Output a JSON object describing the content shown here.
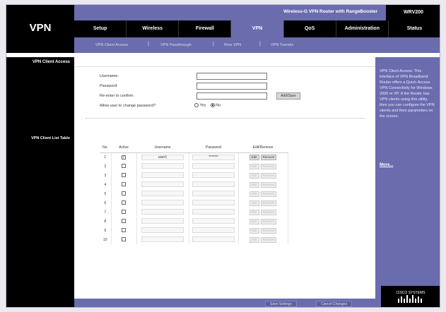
{
  "header": {
    "page_title": "VPN",
    "product_name": "Wireless-G VPN Router with RangeBooster",
    "model": "WRV200"
  },
  "tabs": [
    {
      "label": "Setup"
    },
    {
      "label": "Wireless"
    },
    {
      "label": "Firewall"
    },
    {
      "label": "VPN",
      "active": true
    },
    {
      "label": "QoS"
    },
    {
      "label": "Administration"
    },
    {
      "label": "Status"
    }
  ],
  "subtabs": [
    "VPN Client Access",
    "VPN Passthrough",
    "Rms VPN",
    "VPN Tunnels"
  ],
  "left": {
    "section1": "VPN Client Access",
    "section2": "VPN Client List Table"
  },
  "form": {
    "username_label": "Username:",
    "password_label": "Password:",
    "reenter_label": "Re-enter to confirm:",
    "allow_change_label": "Allow user to change password?",
    "yes_label": "Yes",
    "no_label": "No",
    "add_button": "Add/Save",
    "username_value": "",
    "password_value": "",
    "reenter_value": ""
  },
  "table": {
    "headers": [
      "No.",
      "Active",
      "Username",
      "Password",
      "Edit/Remove"
    ],
    "edit_label": "Edit",
    "remove_label": "Remove",
    "rows": [
      {
        "no": "1",
        "active": true,
        "username": "user1",
        "password": "*******"
      },
      {
        "no": "2",
        "active": false,
        "username": "",
        "password": ""
      },
      {
        "no": "3",
        "active": false,
        "username": "",
        "password": ""
      },
      {
        "no": "4",
        "active": false,
        "username": "",
        "password": ""
      },
      {
        "no": "5",
        "active": false,
        "username": "",
        "password": ""
      },
      {
        "no": "6",
        "active": false,
        "username": "",
        "password": ""
      },
      {
        "no": "7",
        "active": false,
        "username": "",
        "password": ""
      },
      {
        "no": "8",
        "active": false,
        "username": "",
        "password": ""
      },
      {
        "no": "9",
        "active": false,
        "username": "",
        "password": ""
      },
      {
        "no": "10",
        "active": false,
        "username": "",
        "password": ""
      }
    ]
  },
  "help": {
    "text": "VPN Client Access: This interface of VPN Broadband Router offers a Quick-Access VPN Connectivity for Windows 2000 or XP. A the Router has VPN clients using this utility, then you can configure the VPN clients and their parameters on the screen.",
    "more": "More..."
  },
  "footer": {
    "save": "Save Settings",
    "cancel": "Cancel Changes"
  },
  "logo_text": "CISCO SYSTEMS",
  "colors": {
    "accent": "#6a6cae",
    "dark": "#000000"
  }
}
